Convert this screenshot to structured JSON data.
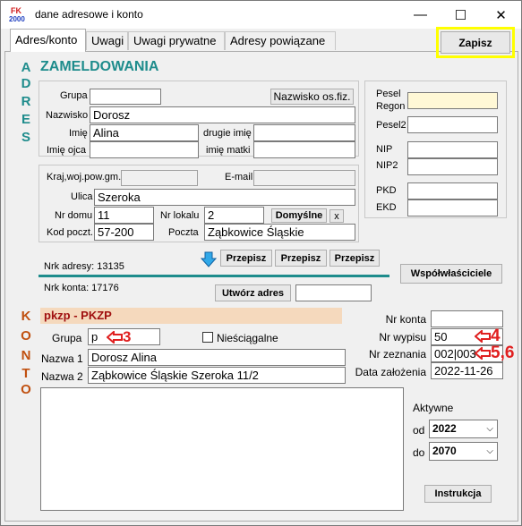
{
  "window": {
    "title": "dane adresowe i konto",
    "icon_label": "FK 2000",
    "minimize": "—",
    "maximize": "☐",
    "close": "✕"
  },
  "tabs": [
    "Adres/konto",
    "Uwagi",
    "Uwagi prywatne",
    "Adresy powiązane"
  ],
  "save_label": "Zapisz",
  "vertical": {
    "adres": [
      "A",
      "D",
      "R",
      "E",
      "S"
    ],
    "konto": [
      "K",
      "O",
      "N",
      "T",
      "O"
    ]
  },
  "zameldowania": {
    "heading": "ZAMELDOWANIA",
    "grupa_label": "Grupa",
    "grupa": "",
    "nazwisko_osfiz_label": "Nazwisko os.fiz.",
    "nazwisko_label": "Nazwisko",
    "nazwisko": "Dorosz",
    "imie_label": "Imię",
    "imie": "Alina",
    "drugie_imie_label": "drugie imię",
    "drugie_imie": "",
    "imie_ojca_label": "Imię ojca",
    "imie_ojca": "",
    "imie_matki_label": "imię matki",
    "imie_matki": ""
  },
  "ids": {
    "pesel_label": "Pesel",
    "regon_label": "Regon",
    "pesel": "",
    "pesel2_label": "Pesel2",
    "pesel2": "",
    "nip_label": "NIP",
    "nip": "",
    "nip2_label": "NIP2",
    "nip2": "",
    "pkd_label": "PKD",
    "pkd": "",
    "ekd_label": "EKD",
    "ekd": ""
  },
  "address": {
    "kraj_label": "Kraj,woj.pow.gm.",
    "kraj": "",
    "email_label": "E-mail",
    "email": "",
    "ulica_label": "Ulica",
    "ulica": "Szeroka",
    "nr_domu_label": "Nr domu",
    "nr_domu": "11",
    "nr_lokalu_label": "Nr lokalu",
    "nr_lokalu": "2",
    "domyslne_label": "Domyślne",
    "x_label": "x",
    "kod_label": "Kod poczt.",
    "kod": "57-200",
    "poczta_label": "Poczta",
    "poczta": "Ząbkowice Śląskie"
  },
  "przepisz": [
    "Przepisz",
    "Przepisz",
    "Przepisz"
  ],
  "nrk_adresy": "Nrk adresy: 13135",
  "wspolwlasciciele_label": "Współwłaściciele",
  "nrk_konta": "Nrk konta:  17176",
  "utworz_adres_label": "Utwórz adres",
  "utworz_field": "",
  "konto": {
    "title": "pkzp - PKZP",
    "grupa_label": "Grupa",
    "grupa": "p",
    "niesciagalne_label": "Nieściągalne",
    "nazwa1_label": "Nazwa 1",
    "nazwa1": "Dorosz Alina",
    "nazwa2_label": "Nazwa 2",
    "nazwa2": "Ząbkowice Śląskie  Szeroka 11/2",
    "nr_konta_label": "Nr konta",
    "nr_konta": "",
    "nr_wypisu_label": "Nr wypisu",
    "nr_wypisu": "50",
    "nr_zeznania_label": "Nr zeznania",
    "nr_zeznania": "002|003",
    "data_zalozenia_label": "Data założenia",
    "data_zalozenia": "2022-11-26",
    "notes": "",
    "aktywne_label": "Aktywne",
    "od_label": "od",
    "od": "2022",
    "do_label": "do",
    "do": "2070",
    "instrukcja_label": "Instrukcja"
  },
  "annotations": {
    "a3": "3",
    "a4": "4",
    "a56": "5,6"
  },
  "colors": {
    "teal": "#1e8c8c",
    "highlight": "#ffff00",
    "annotation": "#e02020"
  }
}
